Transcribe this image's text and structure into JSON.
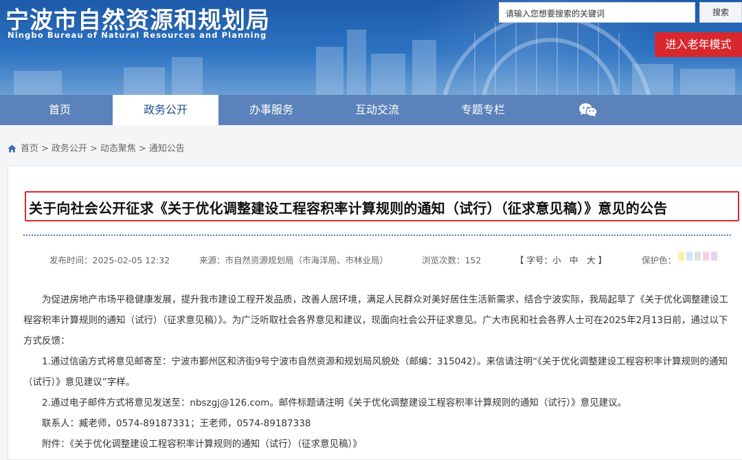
{
  "header": {
    "site_title": "宁波市自然资源和规划局",
    "site_subtitle": "Ningbo Bureau of Natural Resources and Planning",
    "search_placeholder": "请输入您想要搜索的关键词",
    "search_button": "搜索",
    "elder_mode_button": "进入老年模式"
  },
  "nav": {
    "items": [
      {
        "label": "首页",
        "active": false
      },
      {
        "label": "政务公开",
        "active": true
      },
      {
        "label": "办事服务",
        "active": false
      },
      {
        "label": "互动交流",
        "active": false
      },
      {
        "label": "专题专栏",
        "active": false
      }
    ],
    "wechat_icon": "wechat-icon"
  },
  "breadcrumb": {
    "items": [
      "首页",
      "政务公开",
      "动态聚焦",
      "通知公告"
    ],
    "separator": ">"
  },
  "article": {
    "title": "关于向社会公开征求《关于优化调整建设工程容积率计算规则的通知（试行）（征求意见稿）》意见的公告",
    "meta": {
      "publish_time": "发布时间：2025-02-05 12:32",
      "source": "来源：市自然资源规划局（市海洋局、市林业局）",
      "views": "浏览次数：152",
      "font_size": "【 字号：小　中　大 】",
      "eye_protect_label": "保护色："
    },
    "eye_protect_colors": [
      "#f7f2a3",
      "#cfe8f7",
      "#e0e0e0",
      "#f6d2dc",
      "#e2d3f2"
    ],
    "paragraphs": [
      "为促进房地产市场平稳健康发展，提升我市建设工程开发品质，改善人居环境，满足人民群众对美好居住生活新需求，结合宁波实际，我局起草了《关于优化调整建设工程容积率计算规则的通知（试行）（征求意见稿）》。为广泛听取社会各界意见和建议，现面向社会公开征求意见。广大市民和社会各界人士可在2025年2月13日前，通过以下方式反馈：",
      "1.通过信函方式将意见邮寄至：宁波市鄞州区和济街9号宁波市自然资源和规划局风貌处（邮编：315042）。来信请注明“《关于优化调整建设工程容积率计算规则的通知（试行）》意见建议”字样。",
      "2.通过电子邮件方式将意见发送至：nbszgj@126.com。邮件标题请注明《关于优化调整建设工程容积率计算规则的通知（试行）》意见建议。",
      "联系人：臧老师，0574-89187331；王老师，0574-89187338",
      "附件：《关于优化调整建设工程容积率计算规则的通知（试行）（征求意见稿）》"
    ]
  },
  "colors": {
    "nav_bg": "#5b82ba",
    "accent_red": "#d9272e",
    "title_border": "#e0262c"
  }
}
